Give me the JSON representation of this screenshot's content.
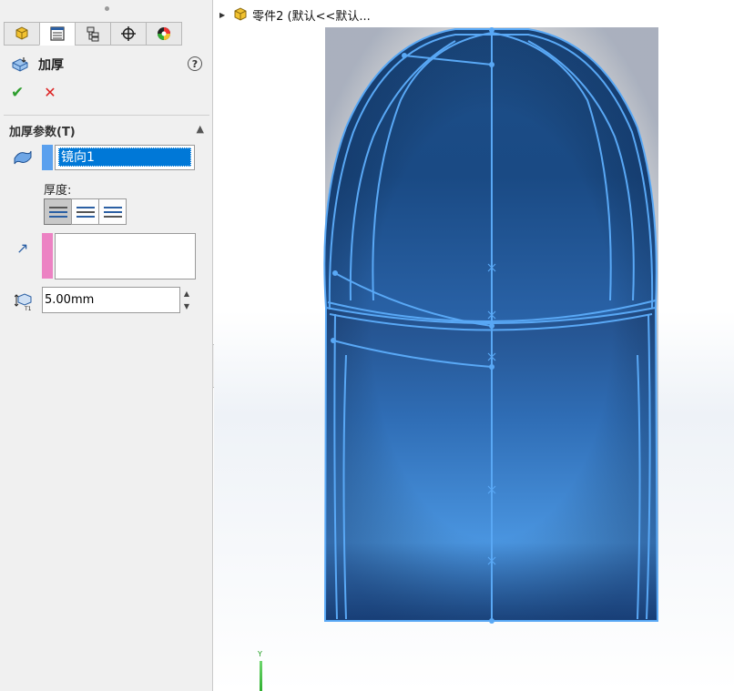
{
  "feature_panel": {
    "tabs": [
      {
        "name": "feature-manager",
        "icon": "part-icon"
      },
      {
        "name": "property-manager",
        "icon": "property-list-icon"
      },
      {
        "name": "configuration-manager",
        "icon": "configuration-icon"
      },
      {
        "name": "dimxpert-manager",
        "icon": "crosshair-icon"
      },
      {
        "name": "display-manager",
        "icon": "appearance-icon"
      }
    ],
    "title": "加厚",
    "help_icon": "?",
    "ok_icon": "✔",
    "cancel_icon": "✕",
    "group": {
      "title": "加厚参数(T)",
      "collapse_icon": "▲",
      "selected_body": "镜向1",
      "thickness_label": "厚度:",
      "thickness_options": [
        "side-1",
        "both-sides",
        "side-2"
      ],
      "depth_value": "5.00mm",
      "depth_icon_label": "T1"
    }
  },
  "viewport": {
    "tree_label": "零件2 (默认<<默认...",
    "triad_label": "Y"
  },
  "colors": {
    "selection_blue": "#0078d7",
    "model_edge": "#4f9ff0",
    "model_fill": "#1c5da8",
    "face_bar_blue": "#5aa0ee",
    "face_bar_pink": "#ec82c3"
  }
}
